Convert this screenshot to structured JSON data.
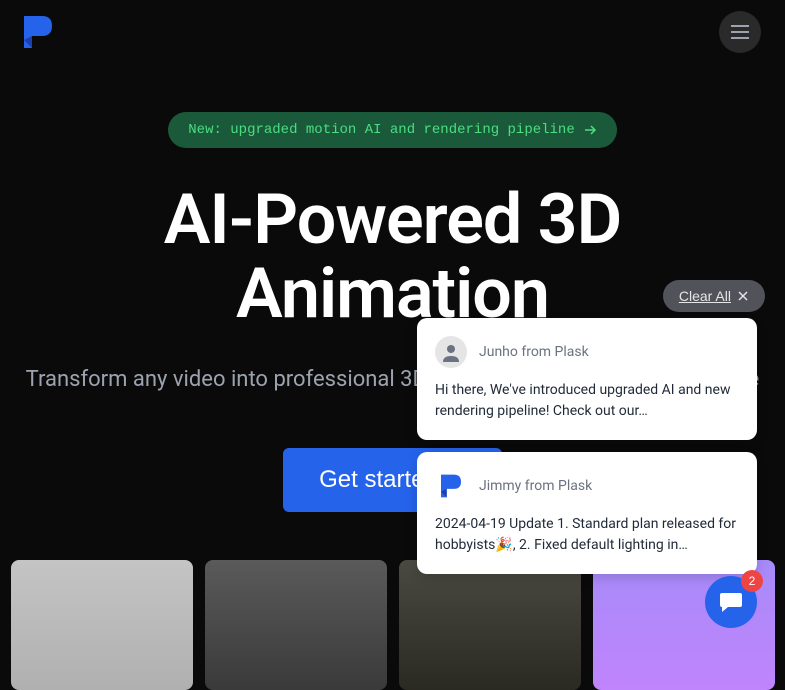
{
  "header": {
    "logo_color": "#2563eb"
  },
  "new_badge": {
    "label": "New: upgraded motion AI and rendering pipeline"
  },
  "hero": {
    "title_line1": "AI-Powered 3D",
    "title_line2": "Animation",
    "subtitle": "Transform any video into professional 3D Animation with AI motion capture",
    "cta_label": "Get started"
  },
  "clear_all": {
    "label": "Clear All"
  },
  "notifications": [
    {
      "from": "Junho from Plask",
      "body": "Hi there, We've introduced upgraded AI and new rendering pipeline! Check out our…",
      "avatar_type": "person"
    },
    {
      "from": "Jimmy from Plask",
      "body": "2024-04-19 Update 1. Standard plan released for hobbyists🎉, 2. Fixed default lighting in…",
      "avatar_type": "logo"
    }
  ],
  "chat": {
    "badge_count": "2"
  }
}
